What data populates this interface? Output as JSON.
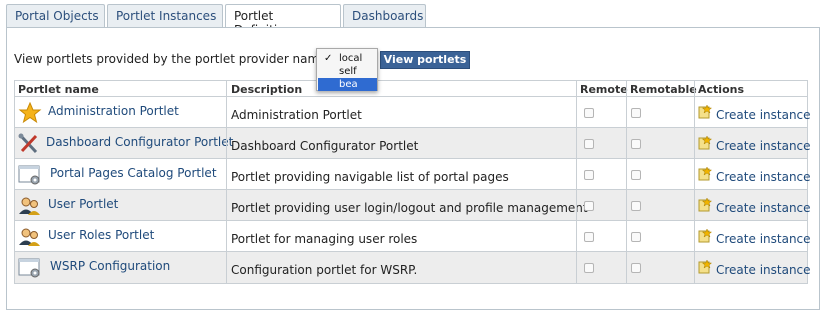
{
  "tabs": [
    {
      "label": "Portal Objects"
    },
    {
      "label": "Portlet Instances"
    },
    {
      "label": "Portlet Definitions",
      "active": true
    },
    {
      "label": "Dashboards"
    }
  ],
  "provider": {
    "label": "View portlets provided by the portlet provider named",
    "options": [
      "local",
      "self",
      "bea"
    ],
    "checked": "local",
    "highlighted": "bea",
    "button_label": "View portlets"
  },
  "table": {
    "headers": {
      "name": "Portlet name",
      "description": "Description",
      "remote": "Remote",
      "remotable": "Remotable",
      "actions": "Actions"
    },
    "rows": [
      {
        "name": "Administration Portlet",
        "description": "Administration Portlet",
        "icon": "star-icon",
        "remote": false,
        "remotable": false,
        "action": "Create instance"
      },
      {
        "name": "Dashboard Configurator Portlet",
        "description": "Dashboard Configurator Portlet",
        "icon": "tools-icon",
        "remote": false,
        "remotable": false,
        "action": "Create instance"
      },
      {
        "name": "Portal Pages Catalog Portlet",
        "description": "Portlet providing navigable list of portal pages",
        "icon": "window-gear-icon",
        "remote": false,
        "remotable": false,
        "action": "Create instance"
      },
      {
        "name": "User Portlet",
        "description": "Portlet providing user login/logout and profile management",
        "icon": "users-icon",
        "remote": false,
        "remotable": false,
        "action": "Create instance"
      },
      {
        "name": "User Roles Portlet",
        "description": "Portlet for managing user roles",
        "icon": "users-icon",
        "remote": false,
        "remotable": false,
        "action": "Create instance"
      },
      {
        "name": "WSRP Configuration",
        "description": "Configuration portlet for WSRP.",
        "icon": "window-gear-icon",
        "remote": false,
        "remotable": false,
        "action": "Create instance"
      }
    ]
  },
  "colors": {
    "link": "#1f4a7b",
    "button": "#3b6397",
    "row_alt": "#ededed",
    "highlight": "#2f6bd1"
  }
}
